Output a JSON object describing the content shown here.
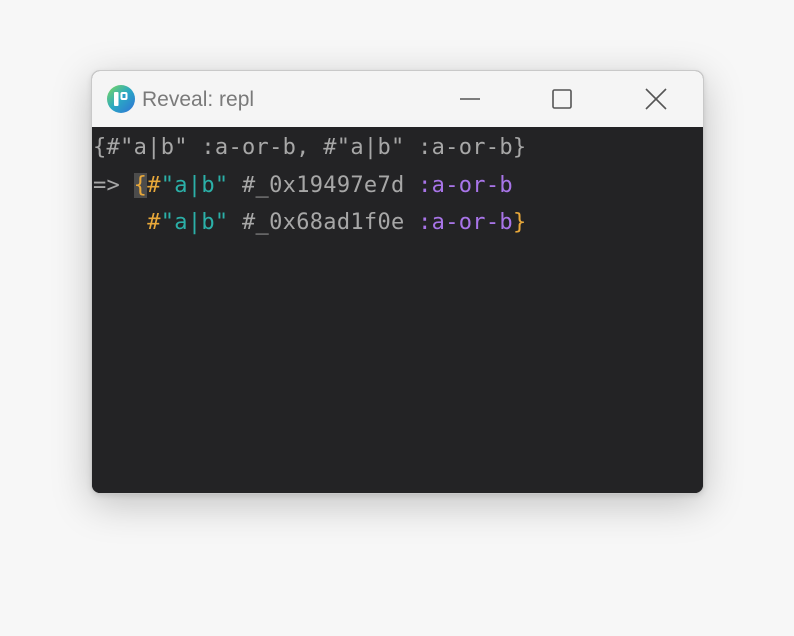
{
  "window": {
    "title": "Reveal: repl",
    "icon": "reveal-logo-icon",
    "controls": {
      "minimize_icon": "minimize-icon",
      "maximize_icon": "maximize-icon",
      "close_icon": "close-icon"
    }
  },
  "repl": {
    "input": "{#\"a|b\" :a-or-b, #\"a|b\" :a-or-b}",
    "prompt": "=> ",
    "result_line1": {
      "brace_open": "{",
      "hash1": "#",
      "str1": "\"a|b\"",
      "tag1": " #_0x19497e7d ",
      "kw1": ":a-or-b"
    },
    "result_line2": {
      "indent": "    ",
      "hash2": "#",
      "str2": "\"a|b\"",
      "tag2": " #_0x68ad1f0e ",
      "kw2": ":a-or-b",
      "brace_close": "}"
    }
  },
  "colors": {
    "background": "#232325",
    "brace": "#e8a83a",
    "string": "#2bb0a8",
    "keyword": "#a874e8",
    "plain": "#a7a7a7"
  }
}
